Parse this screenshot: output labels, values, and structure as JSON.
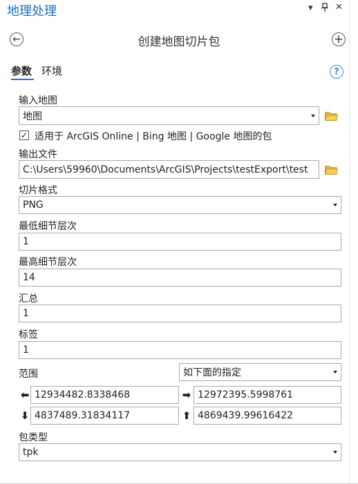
{
  "pane": {
    "title": "地理处理"
  },
  "window": {
    "menu_glyph": "▾",
    "pin_glyph": "ᵽ",
    "close_glyph": "✕"
  },
  "header": {
    "title": "创建地图切片包",
    "back_glyph": "←",
    "add_glyph": "+"
  },
  "tabs": [
    {
      "label": "参数"
    },
    {
      "label": "环境"
    }
  ],
  "help": {
    "glyph": "?"
  },
  "params": {
    "input_map": {
      "label": "输入地图",
      "value": "地图"
    },
    "checkbox": {
      "checked": true,
      "mark": "✓",
      "label": "适用于 ArcGIS Online | Bing 地图 | Google 地图的包"
    },
    "output_file": {
      "label": "输出文件",
      "value": "C:\\Users\\59960\\Documents\\ArcGIS\\Projects\\testExport\\test"
    },
    "tile_format": {
      "label": "切片格式",
      "value": "PNG"
    },
    "min_lod": {
      "label": "最低细节层次",
      "value": "1"
    },
    "max_lod": {
      "label": "最高细节层次",
      "value": "14"
    },
    "summary": {
      "label": "汇总",
      "value": "1"
    },
    "tags": {
      "label": "标签",
      "value": "1"
    },
    "extent": {
      "label": "范围",
      "mode": "如下面的指定",
      "left": "12934482.8338468",
      "right": "12972395.5998761",
      "bottom": "4837489.31834117",
      "top": "4869439.99616422",
      "left_glyph": "⬅",
      "right_glyph": "➡",
      "bottom_glyph": "⬇",
      "top_glyph": "⬆"
    },
    "package_type": {
      "label": "包类型",
      "value": "tpk"
    }
  },
  "colors": {
    "accent": "#1a6fc9",
    "folder": "#e8b83c",
    "field_border": "#a8a8a8"
  }
}
